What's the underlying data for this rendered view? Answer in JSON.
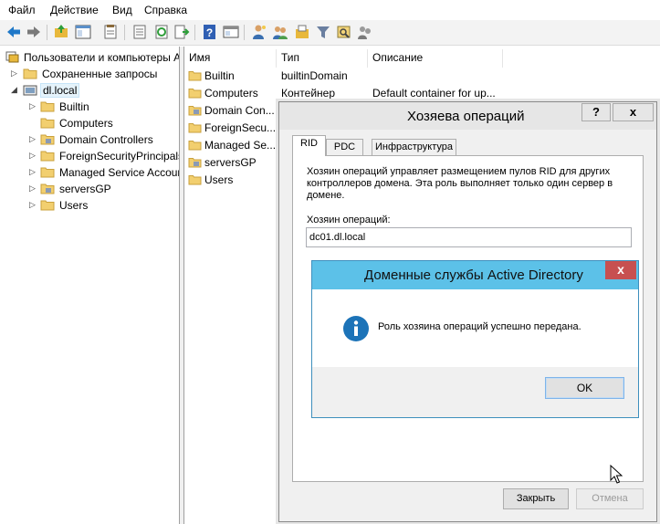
{
  "menu": [
    "Файл",
    "Действие",
    "Вид",
    "Справка"
  ],
  "toolbar": {
    "icons": [
      "back-icon",
      "forward-icon",
      "up-folder-icon",
      "show-tree-icon",
      "properties-icon",
      "export-list-icon",
      "refresh-icon",
      "export-icon",
      "help-icon",
      "console-tree-icon",
      "new-user-icon",
      "new-group-icon",
      "new-ou-icon",
      "filter-icon",
      "find-icon",
      "add-to-group-icon"
    ]
  },
  "tree": {
    "root": "Пользователи и компьютеры А",
    "items": [
      {
        "label": "Сохраненные запросы",
        "level": 1,
        "expander": "▷"
      },
      {
        "label": "dl.local",
        "level": 1,
        "expander": "◢"
      },
      {
        "label": "Builtin",
        "level": 2,
        "expander": "▷"
      },
      {
        "label": "Computers",
        "level": 2,
        "expander": ""
      },
      {
        "label": "Domain Controllers",
        "level": 2,
        "expander": "▷"
      },
      {
        "label": "ForeignSecurityPrincipals",
        "level": 2,
        "expander": "▷"
      },
      {
        "label": "Managed Service Accounts",
        "level": 2,
        "expander": "▷"
      },
      {
        "label": "serversGP",
        "level": 2,
        "expander": "▷"
      },
      {
        "label": "Users",
        "level": 2,
        "expander": "▷"
      }
    ]
  },
  "list": {
    "columns": [
      "Имя",
      "Тип",
      "Описание"
    ],
    "rows": [
      {
        "name": "Builtin",
        "type": "builtinDomain",
        "desc": ""
      },
      {
        "name": "Computers",
        "type": "Контейнер",
        "desc": "Default container for up..."
      },
      {
        "name": "Domain Con...",
        "type": "",
        "desc": ""
      },
      {
        "name": "ForeignSecu...",
        "type": "",
        "desc": ""
      },
      {
        "name": "Managed Se...",
        "type": "",
        "desc": ""
      },
      {
        "name": "serversGP",
        "type": "",
        "desc": ""
      },
      {
        "name": "Users",
        "type": "",
        "desc": ""
      }
    ]
  },
  "ops_dialog": {
    "title": "Хозяева операций",
    "help_label": "?",
    "close_label": "x",
    "tabs": [
      "RID",
      "PDC",
      "Инфраструктура"
    ],
    "description": "Хозяин операций управляет размещением пулов RID для других контроллеров домена. Эта роль выполняет только один сервер в домене.",
    "master_label": "Хозяин операций:",
    "master_value": "dc01.dl.local",
    "close_button": "Закрыть",
    "cancel_button": "Отмена"
  },
  "message_box": {
    "title": "Доменные службы Active Directory",
    "close_label": "x",
    "text": "Роль хозяина операций успешно передана.",
    "icon": "info-icon",
    "ok_label": "OK",
    "colors": {
      "titlebar": "#5cc1e8",
      "close": "#c75050",
      "icon": "#1c73b8"
    }
  }
}
